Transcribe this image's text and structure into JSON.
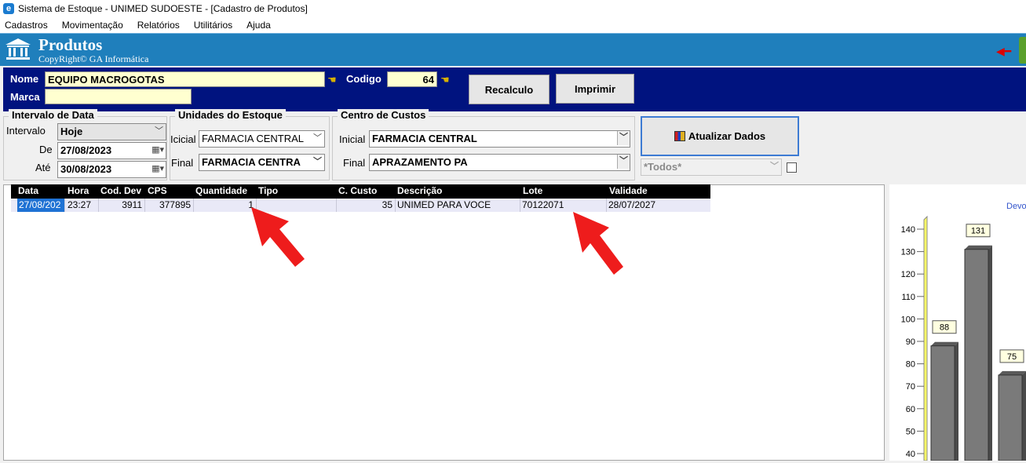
{
  "window": {
    "title": "Sistema de Estoque - UNIMED SUDOESTE - [Cadastro de Produtos]"
  },
  "menu": [
    "Cadastros",
    "Movimentação",
    "Relatórios",
    "Utilitários",
    "Ajuda"
  ],
  "header": {
    "title": "Produtos",
    "subtitle": "CopyRight© GA Informática"
  },
  "product": {
    "nome_label": "Nome",
    "nome_value": "EQUIPO MACROGOTAS",
    "codigo_label": "Codigo",
    "codigo_value": "64",
    "marca_label": "Marca",
    "marca_value": "",
    "recalculo_label": "Recalculo",
    "imprimir_label": "Imprimir"
  },
  "intervalo": {
    "title": "Intervalo de Data",
    "intervalo_label": "Intervalo",
    "intervalo_value": "Hoje",
    "de_label": "De",
    "de_value": "27/08/2023",
    "ate_label": "Até",
    "ate_value": "30/08/2023"
  },
  "unidades": {
    "title": "Unidades do Estoque",
    "inicial_label": "Icicial",
    "inicial_value": "FARMACIA CENTRAL",
    "final_label": "Final",
    "final_value": "FARMACIA CENTRA"
  },
  "centro": {
    "title": "Centro de Custos",
    "inicial_label": "Inicial",
    "inicial_value": "FARMACIA CENTRAL",
    "final_label": "Final",
    "final_value": "APRAZAMENTO PA"
  },
  "actions": {
    "atualizar_label": "Atualizar Dados",
    "todos_value": "*Todos*"
  },
  "table": {
    "columns": [
      "Data",
      "Hora",
      "Cod. Dev",
      "CPS",
      "Quantidade",
      "Tipo",
      "C. Custo",
      "Descrição",
      "Lote",
      "Validade"
    ],
    "rows": [
      [
        "27/08/202",
        "23:27",
        "3911",
        "377895",
        "1",
        "",
        "35",
        "UNIMED PARA VOCE",
        "70122071",
        "28/07/2027"
      ]
    ]
  },
  "chart_data": {
    "type": "bar",
    "title": "Devo",
    "values": [
      88,
      131,
      75
    ],
    "ylim": [
      40,
      140
    ],
    "yticks": [
      "140",
      "130",
      "120",
      "110",
      "100",
      "90",
      "80",
      "70",
      "60",
      "50",
      "40"
    ],
    "bar_color": "#7a7a7a"
  }
}
